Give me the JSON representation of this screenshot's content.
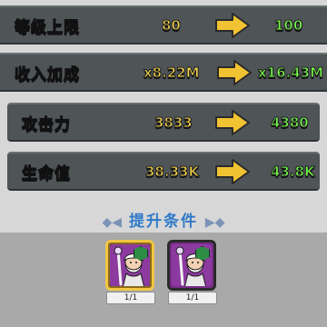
{
  "stats": [
    {
      "label": "等级上限",
      "before": "80",
      "after": "100"
    },
    {
      "label": "收入加成",
      "before": "x8.22M",
      "after": "x16.43M"
    },
    {
      "label": "攻击力",
      "before": "3833",
      "after": "4380"
    },
    {
      "label": "生命值",
      "before": "38.33K",
      "after": "43.8K"
    }
  ],
  "upgrade": {
    "title": "提升条件",
    "decor_left": "◆◀",
    "decor_right": "▶◆"
  },
  "requirements": [
    {
      "count": "1/1",
      "selected": true,
      "icon": "wizard-hero-icon"
    },
    {
      "count": "1/1",
      "selected": false,
      "icon": "wizard-hero-icon"
    }
  ],
  "colors": {
    "before_value": "#f3d24a",
    "after_value": "#75ff4a",
    "arrow": "#f1c232",
    "card_purple": "#8d3aa0",
    "title_blue": "#2f79c9"
  }
}
